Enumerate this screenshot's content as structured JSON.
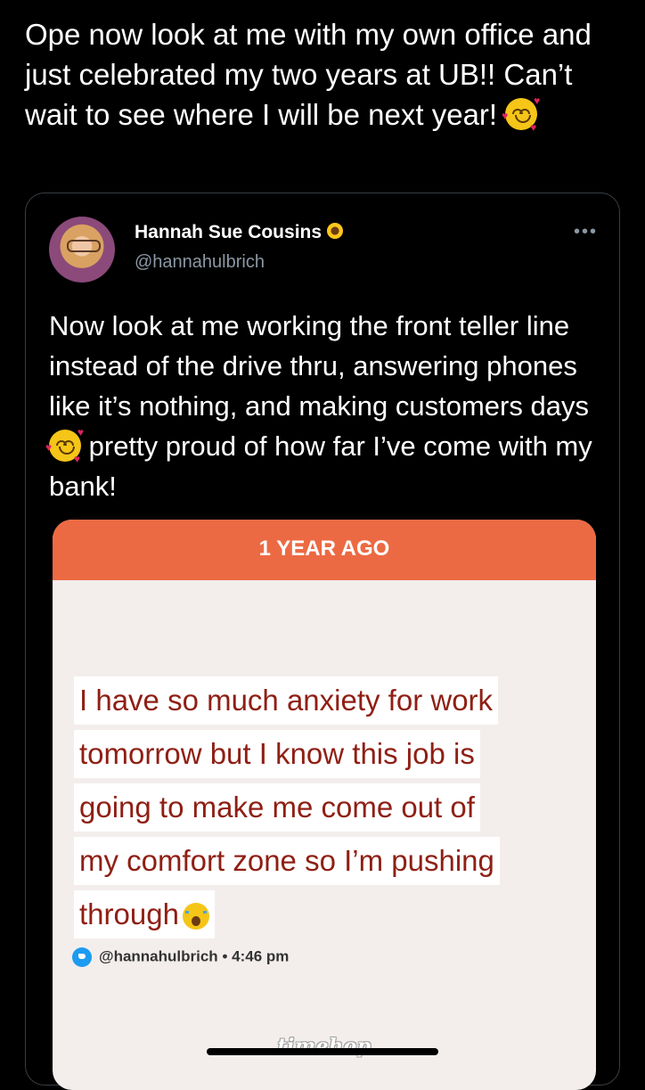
{
  "tweet": {
    "text": "Ope now look at me with my own office and just celebrated my two years at UB!! Can’t wait to see where I will be next year!",
    "emoji": "smiling-face-with-hearts"
  },
  "quoted_tweet": {
    "author_name": "Hannah Sue Cousins",
    "author_badge_emoji": "sunflower",
    "author_handle": "@hannahulbrich",
    "text_part1": "Now look at me working the front teller line instead of the drive thru, answering phones like it’s nothing, and making customers days",
    "text_part2": "pretty proud of how far I’ve come with my bank!",
    "emoji": "smiling-face-with-hearts"
  },
  "timehop": {
    "banner": "1 YEAR AGO",
    "memory_lines": [
      "I have so much anxiety for work",
      "tomorrow but I know this job is",
      "going to make me come out of",
      "my comfort zone so I’m pushing",
      "through"
    ],
    "memory_emoji": "loudly-crying-face",
    "source_handle": "@hannahulbrich",
    "source_separator": "•",
    "source_time": "4:46 pm",
    "logo": "timehop"
  },
  "colors": {
    "background": "#000000",
    "banner": "#ec6a43",
    "memory_text": "#8f1f14",
    "handle_gray": "#8b98a5",
    "twitter_blue": "#1d9bf0"
  }
}
